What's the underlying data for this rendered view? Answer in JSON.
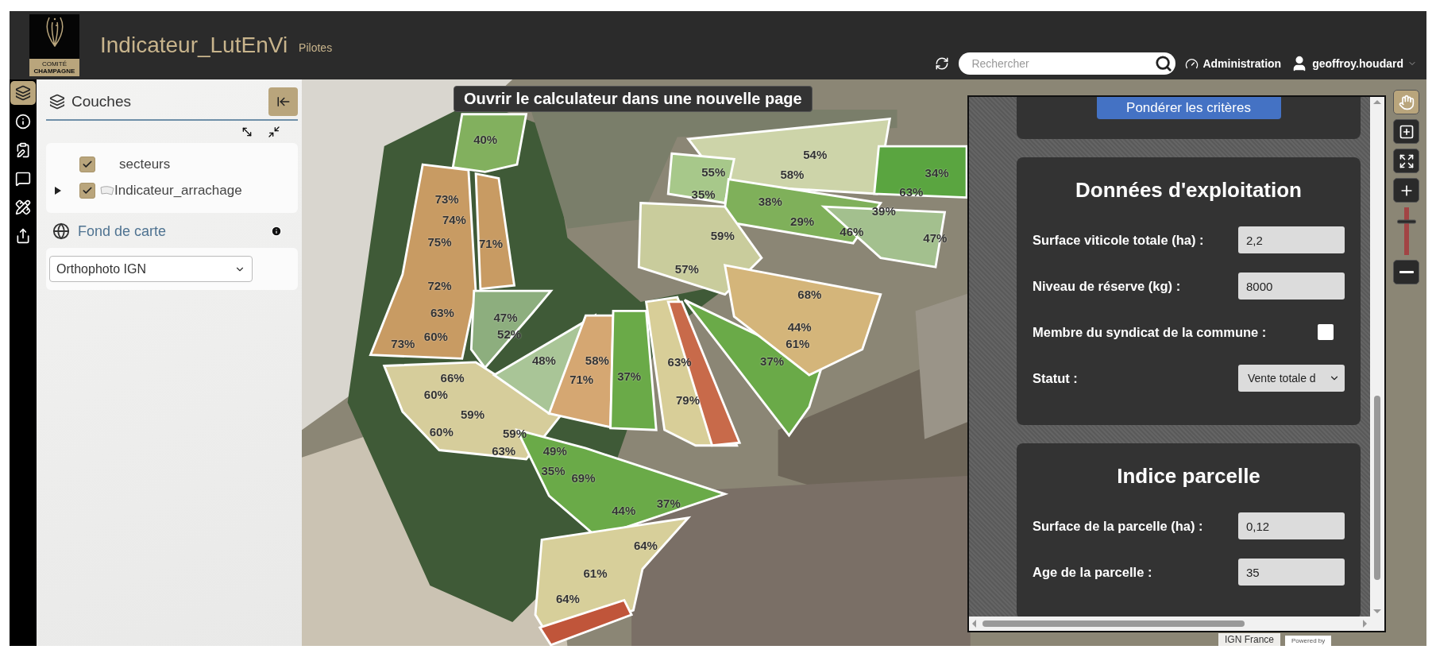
{
  "header": {
    "logo": {
      "line_1": "COMITÉ",
      "line_2": "CHAMPAGNE"
    },
    "title": "Indicateur_LutEnVi",
    "subtitle": "Pilotes",
    "search": {
      "placeholder": "Rechercher"
    },
    "admin_link": "Administration",
    "user": "geoffroy.houdard"
  },
  "left_toolbar": [
    {
      "kind": "layers",
      "selected": true
    },
    {
      "kind": "info",
      "selected": false
    },
    {
      "kind": "edit",
      "selected": false
    },
    {
      "kind": "comment",
      "selected": false
    },
    {
      "kind": "measure",
      "selected": false
    },
    {
      "kind": "share",
      "selected": false
    }
  ],
  "layers_panel": {
    "title": "Couches",
    "layers": [
      {
        "name": "secteurs",
        "checked": true,
        "expandable": false
      },
      {
        "name": "Indicateur_arrachage",
        "checked": true,
        "expandable": true
      }
    ],
    "basemap": {
      "title": "Fond de carte",
      "value": "Orthophoto IGN"
    }
  },
  "map": {
    "calculator_link": "Ouvrir le calculateur dans une nouvelle page",
    "parcel_labels": [
      "40%",
      "73%",
      "74%",
      "75%",
      "71%",
      "72%",
      "63%",
      "60%",
      "73%",
      "47%",
      "52%",
      "66%",
      "60%",
      "59%",
      "60%",
      "59%",
      "63%",
      "48%",
      "58%",
      "71%",
      "37%",
      "63%",
      "79%",
      "37%",
      "55%",
      "35%",
      "54%",
      "58%",
      "38%",
      "29%",
      "34%",
      "63%",
      "39%",
      "46%",
      "59%",
      "47%",
      "57%",
      "68%",
      "44%",
      "61%",
      "49%",
      "35%",
      "69%",
      "44%",
      "37%",
      "64%",
      "61%",
      "64%"
    ],
    "attribution": "IGN France",
    "powered_by": "Powered by"
  },
  "map_tools": [
    {
      "kind": "pan",
      "selected": true
    },
    {
      "kind": "zoom-box",
      "selected": false
    },
    {
      "kind": "full-extent",
      "selected": false
    },
    {
      "kind": "zoom-in",
      "selected": false
    },
    {
      "kind": "zoom-slider",
      "level": 0.75
    },
    {
      "kind": "zoom-out",
      "selected": false
    }
  ],
  "calculator": {
    "weight_button": "Pondérer les critères",
    "sections": [
      {
        "title": "Données d'exploitation",
        "fields": [
          {
            "kind": "text",
            "label": "Surface viticole totale (ha) :",
            "value": "2,2"
          },
          {
            "kind": "text",
            "label": "Niveau de réserve (kg) :",
            "value": "8000"
          },
          {
            "kind": "checkbox",
            "label": "Membre du syndicat de la commune :",
            "checked": false
          },
          {
            "kind": "select",
            "label": "Statut :",
            "value": "Vente totale d"
          }
        ]
      },
      {
        "title": "Indice parcelle",
        "fields": [
          {
            "kind": "text",
            "label": "Surface de la parcelle (ha) :",
            "value": "0,12"
          },
          {
            "kind": "text",
            "label": "Age de la parcelle :",
            "value": "35"
          }
        ]
      }
    ]
  }
}
